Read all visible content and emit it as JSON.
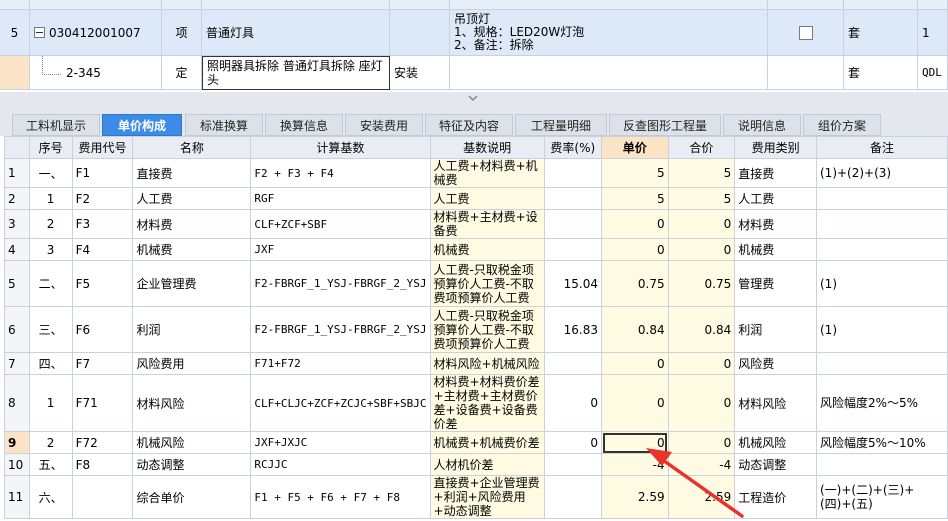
{
  "top_grid": {
    "row_partial": {
      "index": "",
      "code": "",
      "unit": "",
      "name": ""
    },
    "row1": {
      "index": "5",
      "code": "030412001007",
      "kind": "项",
      "name": "普通灯具",
      "feature_lines": [
        "吊顶灯",
        "1、规格：LED20W灯泡",
        "2、备注：拆除"
      ],
      "unit": "套",
      "qty": "1"
    },
    "row2": {
      "index": "",
      "code": "2-345",
      "kind": "定",
      "name": "照明器具拆除 普通灯具拆除 座灯头",
      "category": "安装",
      "unit": "套",
      "extra": "QDL"
    }
  },
  "tabs": [
    {
      "label": "工料机显示",
      "active": false
    },
    {
      "label": "单价构成",
      "active": true
    },
    {
      "label": "标准换算",
      "active": false
    },
    {
      "label": "换算信息",
      "active": false
    },
    {
      "label": "安装费用",
      "active": false
    },
    {
      "label": "特征及内容",
      "active": false
    },
    {
      "label": "工程量明细",
      "active": false
    },
    {
      "label": "反查图形工程量",
      "active": false
    },
    {
      "label": "说明信息",
      "active": false
    },
    {
      "label": "组价方案",
      "active": false
    }
  ],
  "table": {
    "headers": [
      "",
      "序号",
      "费用代号",
      "名称",
      "计算基数",
      "基数说明",
      "费率(%)",
      "单价",
      "合价",
      "费用类别",
      "备注"
    ],
    "rows": [
      {
        "n": "1",
        "seq": "一、",
        "code": "F1",
        "name": "直接费",
        "base": "F2 + F3 + F4",
        "desc": "人工费+材料费+机械费",
        "rate": "",
        "unit_price": "5",
        "total": "5",
        "cat": "直接费",
        "note": "(1)+(2)+(3)"
      },
      {
        "n": "2",
        "seq": "1",
        "code": "F2",
        "name": "人工费",
        "base": "RGF",
        "desc": "人工费",
        "rate": "",
        "unit_price": "5",
        "total": "5",
        "cat": "人工费",
        "note": ""
      },
      {
        "n": "3",
        "seq": "2",
        "code": "F3",
        "name": "材料费",
        "base": "CLF+ZCF+SBF",
        "desc": "材料费+主材费+设备费",
        "rate": "",
        "unit_price": "0",
        "total": "0",
        "cat": "材料费",
        "note": ""
      },
      {
        "n": "4",
        "seq": "3",
        "code": "F4",
        "name": "机械费",
        "base": "JXF",
        "desc": "机械费",
        "rate": "",
        "unit_price": "0",
        "total": "0",
        "cat": "机械费",
        "note": ""
      },
      {
        "n": "5",
        "seq": "二、",
        "code": "F5",
        "name": "企业管理费",
        "base": "F2-FBRGF_1_YSJ-FBRGF_2_YSJ",
        "desc": "人工费-只取税金项预算价人工费-不取费项预算价人工费",
        "rate": "15.04",
        "unit_price": "0.75",
        "total": "0.75",
        "cat": "管理费",
        "note": "(1)"
      },
      {
        "n": "6",
        "seq": "三、",
        "code": "F6",
        "name": "利润",
        "base": "F2-FBRGF_1_YSJ-FBRGF_2_YSJ",
        "desc": "人工费-只取税金项预算价人工费-不取费项预算价人工费",
        "rate": "16.83",
        "unit_price": "0.84",
        "total": "0.84",
        "cat": "利润",
        "note": "(1)"
      },
      {
        "n": "7",
        "seq": "四、",
        "code": "F7",
        "name": "风险费用",
        "base": "F71+F72",
        "desc": "材料风险+机械风险",
        "rate": "",
        "unit_price": "0",
        "total": "0",
        "cat": "风险费",
        "note": ""
      },
      {
        "n": "8",
        "seq": "1",
        "code": "F71",
        "name": "材料风险",
        "base": "CLF+CLJC+ZCF+ZCJC+SBF+SBJC",
        "desc": "材料费+材料费价差+主材费+主材费价差+设备费+设备费价差",
        "rate": "0",
        "unit_price": "0",
        "total": "0",
        "cat": "材料风险",
        "note": "风险幅度2%～5%"
      },
      {
        "n": "9",
        "seq": "2",
        "code": "F72",
        "name": "机械风险",
        "base": "JXF+JXJC",
        "desc": "机械费+机械费价差",
        "rate": "0",
        "unit_price": "0",
        "total": "0",
        "cat": "机械风险",
        "note": "风险幅度5%～10%"
      },
      {
        "n": "10",
        "seq": "五、",
        "code": "F8",
        "name": "动态调整",
        "base": "RCJJC",
        "desc": "人材机价差",
        "rate": "",
        "unit_price": "-4",
        "total": "-4",
        "cat": "动态调整",
        "note": ""
      },
      {
        "n": "11",
        "seq": "六、",
        "code": "",
        "name": "综合单价",
        "base": "F1 + F5 + F6 + F7 + F8",
        "desc": "直接费+企业管理费+利润+风险费用+动态调整",
        "rate": "",
        "unit_price": "2.59",
        "total": "2.59",
        "cat": "工程造价",
        "note": "(一)+(二)+(三)+(四)+(五)"
      }
    ]
  },
  "colors": {
    "tab_active": "#3c8ce7",
    "highlight": "#fbe4c5",
    "desc_bg": "#fffbe3",
    "arrow": "#e8322a"
  }
}
